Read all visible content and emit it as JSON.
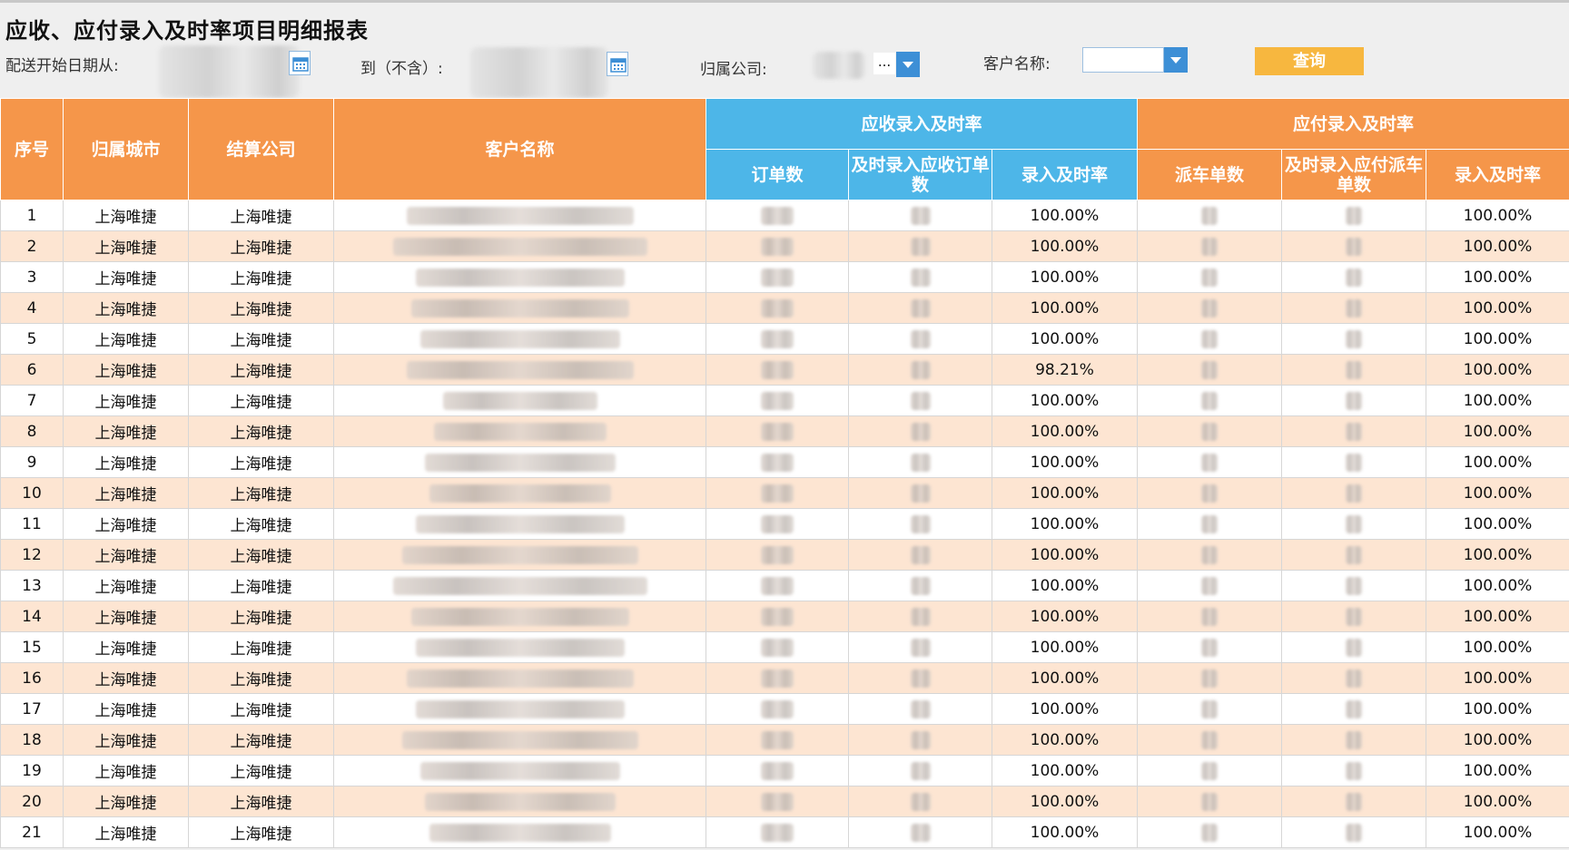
{
  "report": {
    "title": "应收、应付录入及时率项目明细报表"
  },
  "filters": {
    "start_date_label": "配送开始日期从:",
    "end_date_label": "到（不含）:",
    "company_label": "归属公司:",
    "company_value": "...",
    "customer_label": "客户名称:",
    "customer_value": "",
    "query_label": "查询"
  },
  "table": {
    "header": {
      "seq": "序号",
      "city": "归属城市",
      "settle_company": "结算公司",
      "customer": "客户名称",
      "receivable_group": "应收录入及时率",
      "order_count": "订单数",
      "timely_receivable_orders": "及时录入应收订单数",
      "receivable_rate": "录入及时率",
      "payable_group": "应付录入及时率",
      "dispatch_count": "派车单数",
      "timely_payable_dispatch": "及时录入应付派车单数",
      "payable_rate": "录入及时率"
    },
    "rows": [
      {
        "seq": "1",
        "city": "上海唯捷",
        "company": "上海唯捷",
        "recv_rate": "100.00%",
        "pay_rate": "100.00%"
      },
      {
        "seq": "2",
        "city": "上海唯捷",
        "company": "上海唯捷",
        "recv_rate": "100.00%",
        "pay_rate": "100.00%"
      },
      {
        "seq": "3",
        "city": "上海唯捷",
        "company": "上海唯捷",
        "recv_rate": "100.00%",
        "pay_rate": "100.00%"
      },
      {
        "seq": "4",
        "city": "上海唯捷",
        "company": "上海唯捷",
        "recv_rate": "100.00%",
        "pay_rate": "100.00%"
      },
      {
        "seq": "5",
        "city": "上海唯捷",
        "company": "上海唯捷",
        "recv_rate": "100.00%",
        "pay_rate": "100.00%"
      },
      {
        "seq": "6",
        "city": "上海唯捷",
        "company": "上海唯捷",
        "recv_rate": "98.21%",
        "pay_rate": "100.00%"
      },
      {
        "seq": "7",
        "city": "上海唯捷",
        "company": "上海唯捷",
        "recv_rate": "100.00%",
        "pay_rate": "100.00%"
      },
      {
        "seq": "8",
        "city": "上海唯捷",
        "company": "上海唯捷",
        "recv_rate": "100.00%",
        "pay_rate": "100.00%"
      },
      {
        "seq": "9",
        "city": "上海唯捷",
        "company": "上海唯捷",
        "recv_rate": "100.00%",
        "pay_rate": "100.00%"
      },
      {
        "seq": "10",
        "city": "上海唯捷",
        "company": "上海唯捷",
        "recv_rate": "100.00%",
        "pay_rate": "100.00%"
      },
      {
        "seq": "11",
        "city": "上海唯捷",
        "company": "上海唯捷",
        "recv_rate": "100.00%",
        "pay_rate": "100.00%"
      },
      {
        "seq": "12",
        "city": "上海唯捷",
        "company": "上海唯捷",
        "recv_rate": "100.00%",
        "pay_rate": "100.00%"
      },
      {
        "seq": "13",
        "city": "上海唯捷",
        "company": "上海唯捷",
        "recv_rate": "100.00%",
        "pay_rate": "100.00%"
      },
      {
        "seq": "14",
        "city": "上海唯捷",
        "company": "上海唯捷",
        "recv_rate": "100.00%",
        "pay_rate": "100.00%"
      },
      {
        "seq": "15",
        "city": "上海唯捷",
        "company": "上海唯捷",
        "recv_rate": "100.00%",
        "pay_rate": "100.00%"
      },
      {
        "seq": "16",
        "city": "上海唯捷",
        "company": "上海唯捷",
        "recv_rate": "100.00%",
        "pay_rate": "100.00%"
      },
      {
        "seq": "17",
        "city": "上海唯捷",
        "company": "上海唯捷",
        "recv_rate": "100.00%",
        "pay_rate": "100.00%"
      },
      {
        "seq": "18",
        "city": "上海唯捷",
        "company": "上海唯捷",
        "recv_rate": "100.00%",
        "pay_rate": "100.00%"
      },
      {
        "seq": "19",
        "city": "上海唯捷",
        "company": "上海唯捷",
        "recv_rate": "100.00%",
        "pay_rate": "100.00%"
      },
      {
        "seq": "20",
        "city": "上海唯捷",
        "company": "上海唯捷",
        "recv_rate": "100.00%",
        "pay_rate": "100.00%"
      },
      {
        "seq": "21",
        "city": "上海唯捷",
        "company": "上海唯捷",
        "recv_rate": "100.00%",
        "pay_rate": "100.00%"
      }
    ]
  },
  "colors": {
    "header_orange": "#f5964a",
    "header_blue": "#4db6e8",
    "row_alt": "#fde5d2",
    "query_button": "#f7b73f",
    "dropdown_arrow": "#3d8fd6"
  },
  "icons": {
    "calendar": "calendar-icon",
    "dropdown": "chevron-down-icon"
  }
}
